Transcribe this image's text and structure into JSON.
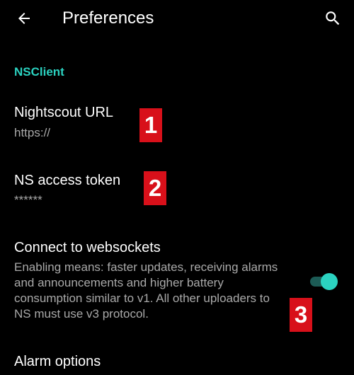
{
  "toolbar": {
    "title": "Preferences",
    "back_icon": "arrow-back-icon",
    "search_icon": "search-icon"
  },
  "category": {
    "label": "NSClient"
  },
  "prefs": {
    "url": {
      "title": "Nightscout URL",
      "summary": "https://"
    },
    "token": {
      "title": "NS access token",
      "summary": "******"
    },
    "websockets": {
      "title": "Connect to websockets",
      "summary": "Enabling means: faster updates, receiving alarms and announcements and higher battery consumption similar to v1. All other uploaders to NS must use v3 protocol.",
      "enabled": true
    },
    "alarm": {
      "title": "Alarm options"
    }
  },
  "badges": [
    "1",
    "2",
    "3"
  ],
  "colors": {
    "accent": "#2bd2c0",
    "badge": "#d8101a",
    "background": "#000000",
    "summary_text": "#a9a9a9"
  }
}
